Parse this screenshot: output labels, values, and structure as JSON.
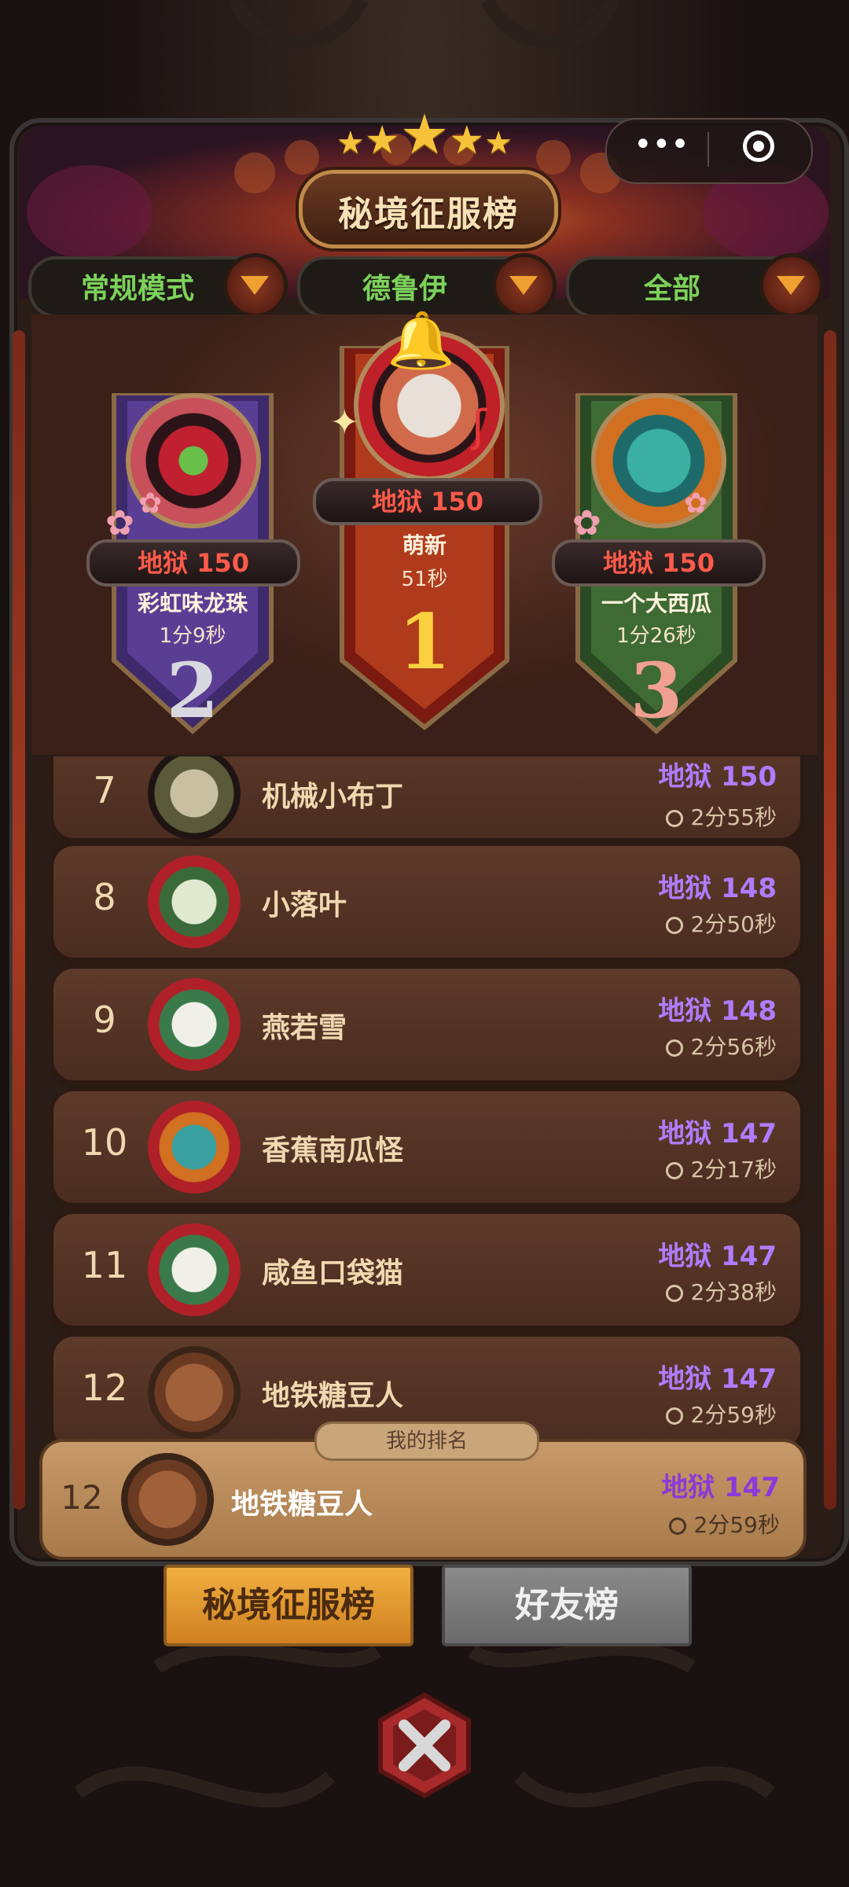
{
  "header": {
    "title": "秘境征服榜",
    "stars": 5
  },
  "filters": [
    {
      "label": "常规模式"
    },
    {
      "label": "德鲁伊"
    },
    {
      "label": "全部"
    }
  ],
  "podium": [
    {
      "rank": "1",
      "level": "地狱 150",
      "name": "萌新",
      "time": "51秒"
    },
    {
      "rank": "2",
      "level": "地狱 150",
      "name": "彩虹味龙珠",
      "time": "1分9秒"
    },
    {
      "rank": "3",
      "level": "地狱 150",
      "name": "一个大西瓜",
      "time": "1分26秒"
    }
  ],
  "rows": [
    {
      "rank": "7",
      "name": "机械小布丁",
      "level": "地狱 150",
      "time": "2分55秒"
    },
    {
      "rank": "8",
      "name": "小落叶",
      "level": "地狱 148",
      "time": "2分50秒"
    },
    {
      "rank": "9",
      "name": "燕若雪",
      "level": "地狱 148",
      "time": "2分56秒"
    },
    {
      "rank": "10",
      "name": "香蕉南瓜怪",
      "level": "地狱 147",
      "time": "2分17秒"
    },
    {
      "rank": "11",
      "name": "咸鱼口袋猫",
      "level": "地狱 147",
      "time": "2分38秒"
    },
    {
      "rank": "12",
      "name": "地铁糖豆人",
      "level": "地狱 147",
      "time": "2分59秒"
    }
  ],
  "my_rank": {
    "tag": "我的排名",
    "rank": "12",
    "name": "地铁糖豆人",
    "level": "地狱 147",
    "time": "2分59秒"
  },
  "tabs": [
    {
      "label": "秘境征服榜"
    },
    {
      "label": "好友榜"
    }
  ],
  "colors": {
    "accent_green": "#7cd25a",
    "hell_red": "#ff5a4a",
    "hell_purple": "#b07cff",
    "tab_active": "#f0a030"
  }
}
